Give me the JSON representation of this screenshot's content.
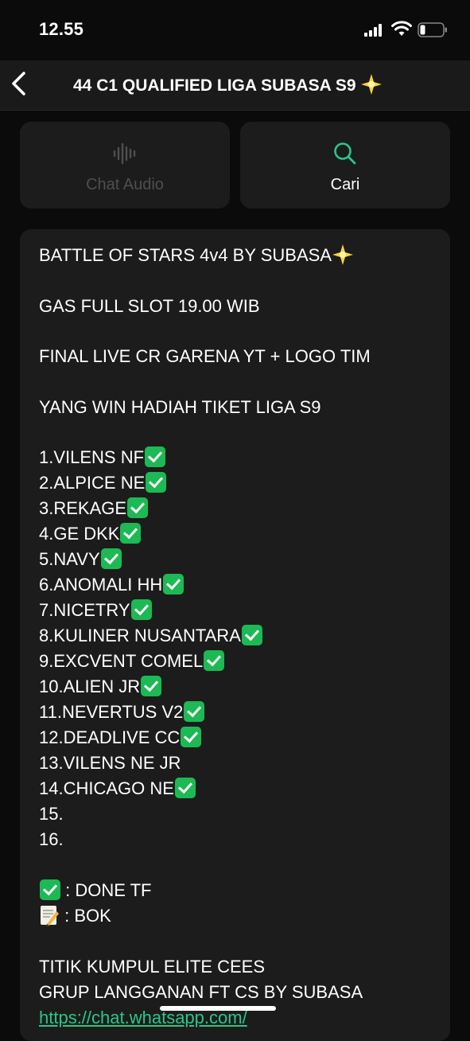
{
  "status_bar": {
    "time": "12.55"
  },
  "header": {
    "title": "44 C1 QUALIFIED LIGA SUBASA S9"
  },
  "actions": {
    "audio_label": "Chat Audio",
    "search_label": "Cari"
  },
  "description": {
    "heading": "BATTLE OF STARS  4v4 BY SUBASA",
    "schedule": "GAS FULL SLOT 19.00 WIB",
    "final": "FINAL LIVE CR GARENA YT + LOGO TIM",
    "prize": "YANG WIN HADIAH TIKET LIGA S9",
    "teams": [
      {
        "text": "1.VILENS NF",
        "done": true
      },
      {
        "text": "2.ALPICE NE",
        "done": true
      },
      {
        "text": "3.REKAGE",
        "done": true
      },
      {
        "text": "4.GE DKK",
        "done": true
      },
      {
        "text": "5.NAVY",
        "done": true
      },
      {
        "text": "6.ANOMALI HH",
        "done": true
      },
      {
        "text": "7.NICETRY",
        "done": true
      },
      {
        "text": "8.KULINER NUSANTARA",
        "done": true
      },
      {
        "text": "9.EXCVENT COMEL",
        "done": true
      },
      {
        "text": "10.ALIEN JR",
        "done": true
      },
      {
        "text": "11.NEVERTUS V2",
        "done": true
      },
      {
        "text": "12.DEADLIVE CC",
        "done": true
      },
      {
        "text": "13.VILENS NE JR",
        "done": false
      },
      {
        "text": "14.CHICAGO NE",
        "done": true
      },
      {
        "text": "15.",
        "done": false
      },
      {
        "text": "16.",
        "done": false
      }
    ],
    "legend_done": " : DONE TF",
    "legend_bok": " : BOK",
    "footer_1": "TITIK KUMPUL ELITE CEES",
    "footer_2": "GRUP LANGGANAN FT CS BY SUBASA",
    "link": "https://chat.whatsapp.com/"
  },
  "colors": {
    "accent": "#27c78a",
    "check": "#1db954",
    "card": "#1c1c1c",
    "background": "#0b0b0b"
  },
  "icons": [
    "back-chevron-icon",
    "audio-wave-icon",
    "search-icon",
    "check-box-icon",
    "memo-icon",
    "star-icon"
  ]
}
